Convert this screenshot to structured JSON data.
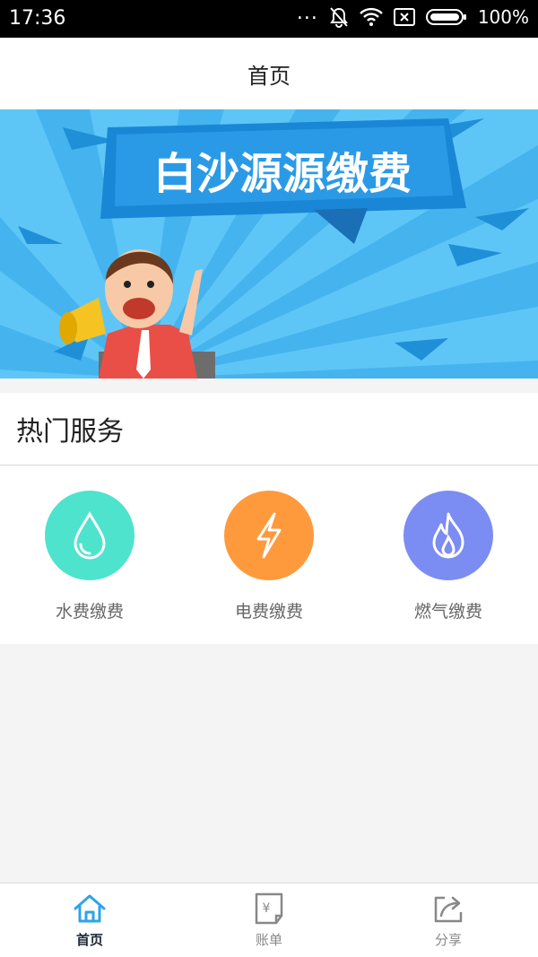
{
  "status": {
    "time": "17:36",
    "dots": "...",
    "battery": "100%"
  },
  "page": {
    "title": "首页"
  },
  "banner": {
    "headline": "白沙源源缴费"
  },
  "services": {
    "heading": "热门服务",
    "items": [
      {
        "label": "水费缴费",
        "icon": "water-drop-icon",
        "color": "#4ee3cc"
      },
      {
        "label": "电费缴费",
        "icon": "lightning-icon",
        "color": "#ff9a3c"
      },
      {
        "label": "燃气缴费",
        "icon": "flame-icon",
        "color": "#7b8cf2"
      }
    ]
  },
  "tabbar": {
    "tabs": [
      {
        "label": "首页",
        "icon": "home-icon",
        "active": true
      },
      {
        "label": "账单",
        "icon": "bill-icon",
        "active": false
      },
      {
        "label": "分享",
        "icon": "share-icon",
        "active": false
      }
    ]
  },
  "colors": {
    "accent": "#2ea4e8",
    "banner_bg": "#5ec6f6",
    "banner_dark": "#1a86d6"
  }
}
